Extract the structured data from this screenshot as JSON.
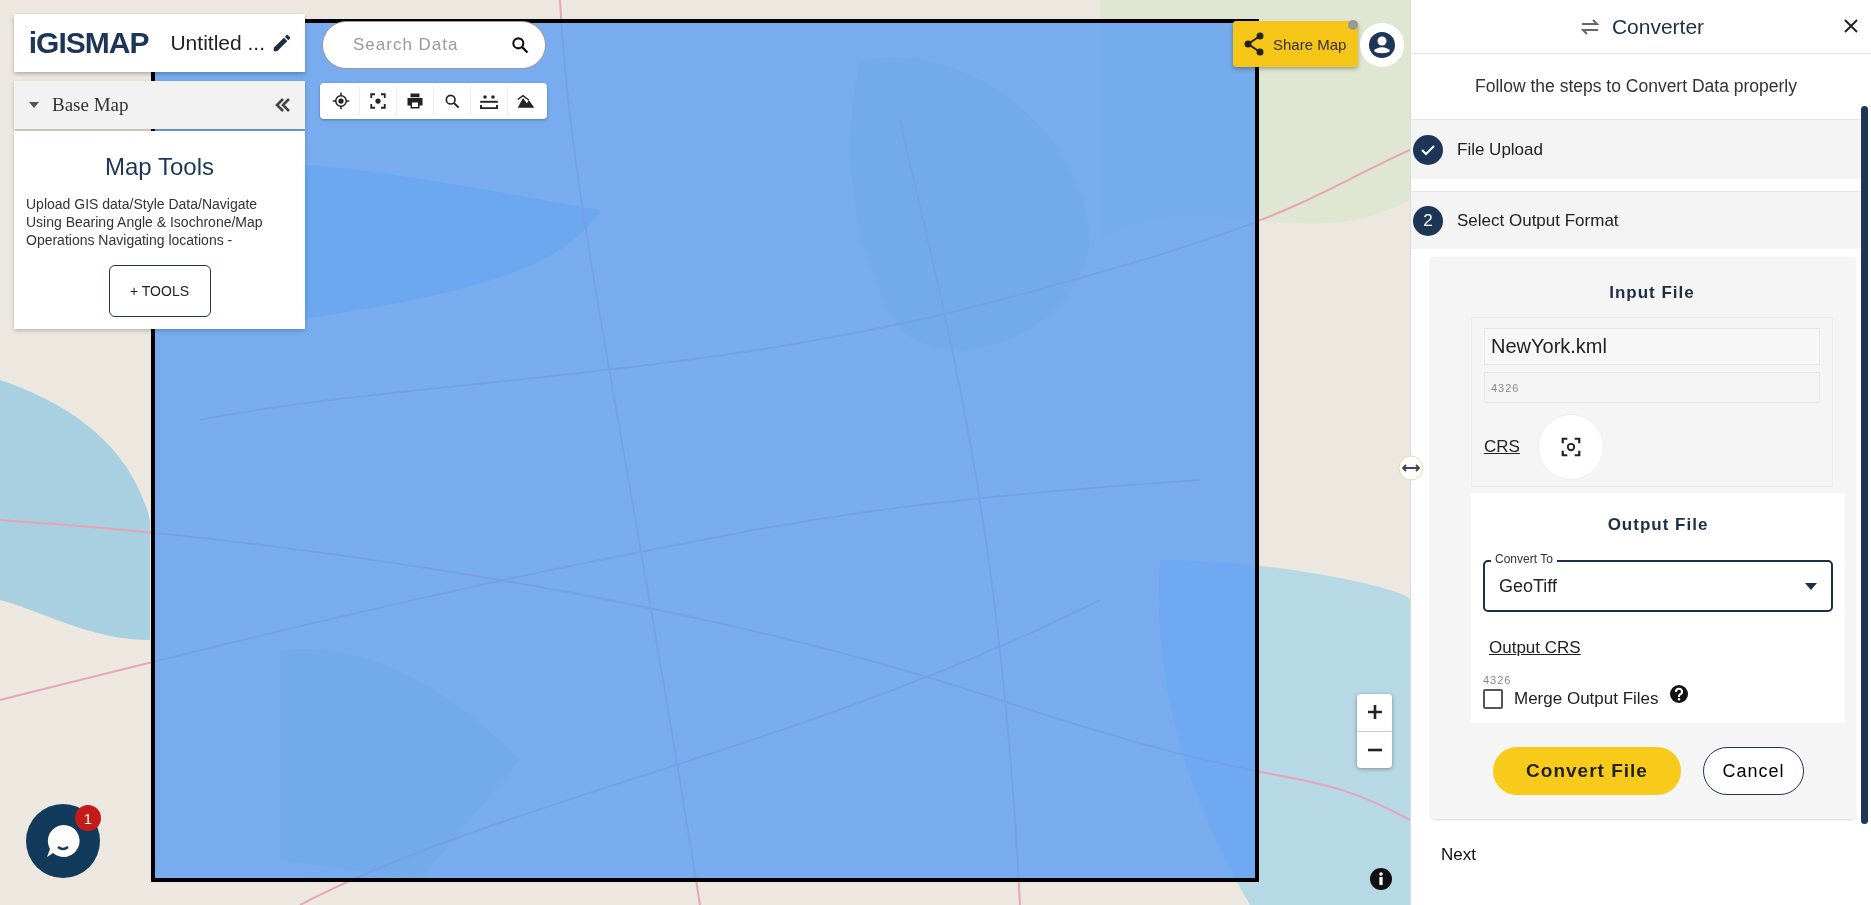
{
  "app": {
    "logo": "iGISMAP",
    "title": "Untitled ..."
  },
  "base_map": {
    "label": "Base Map"
  },
  "map_tools": {
    "title": "Map Tools",
    "description": "Upload GIS data/Style Data/Navigate Using Bearing Angle & Isochrone/Map Operations Navigating locations -",
    "button": "+ TOOLS"
  },
  "search": {
    "placeholder": "Search Data"
  },
  "share_button": "Share Map",
  "chat": {
    "badge": "1"
  },
  "converter": {
    "title": "Converter",
    "subtitle": "Follow the steps to Convert Data properly",
    "steps": [
      {
        "label": "File Upload",
        "done": true
      },
      {
        "label": "Select Output Format",
        "number": "2",
        "done": false
      }
    ],
    "input_file": {
      "heading": "Input File",
      "file_name": "NewYork.kml",
      "crs_code": "4326",
      "crs_label": "CRS"
    },
    "output_file": {
      "heading": "Output File",
      "convert_to_label": "Convert To",
      "convert_to_value": "GeoTiff",
      "crs_label": "Output CRS",
      "crs_code": "4326",
      "merge_label": "Merge Output Files",
      "merge_checked": false
    },
    "buttons": [
      {
        "label": "Convert File",
        "kind": "primary"
      },
      {
        "label": "Cancel",
        "kind": "secondary"
      }
    ],
    "next": "Next"
  }
}
